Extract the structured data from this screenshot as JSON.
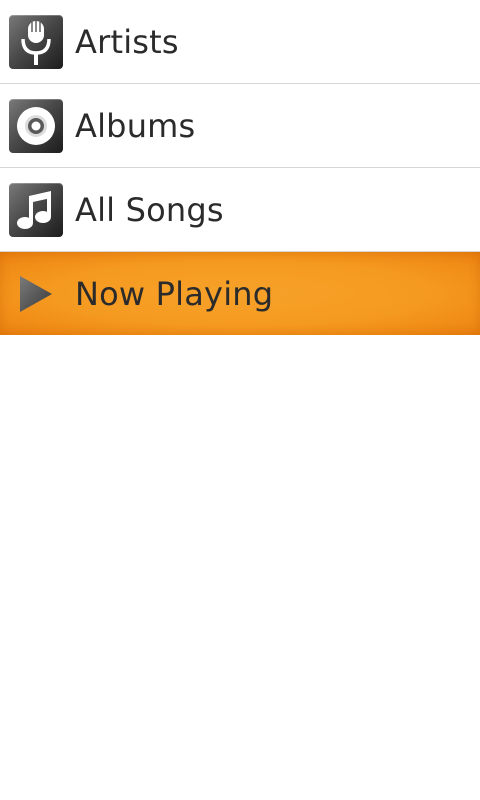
{
  "menu": {
    "items": [
      {
        "label": "Artists",
        "icon": "microphone-icon"
      },
      {
        "label": "Albums",
        "icon": "disc-icon"
      },
      {
        "label": "All Songs",
        "icon": "music-note-icon"
      },
      {
        "label": "Now Playing",
        "icon": "play-icon",
        "selected": true
      }
    ]
  },
  "colors": {
    "highlight": "#f59a20",
    "icon_tile": "#4a4a4a",
    "text": "#2b2b2b",
    "divider": "#d6d6d6"
  }
}
